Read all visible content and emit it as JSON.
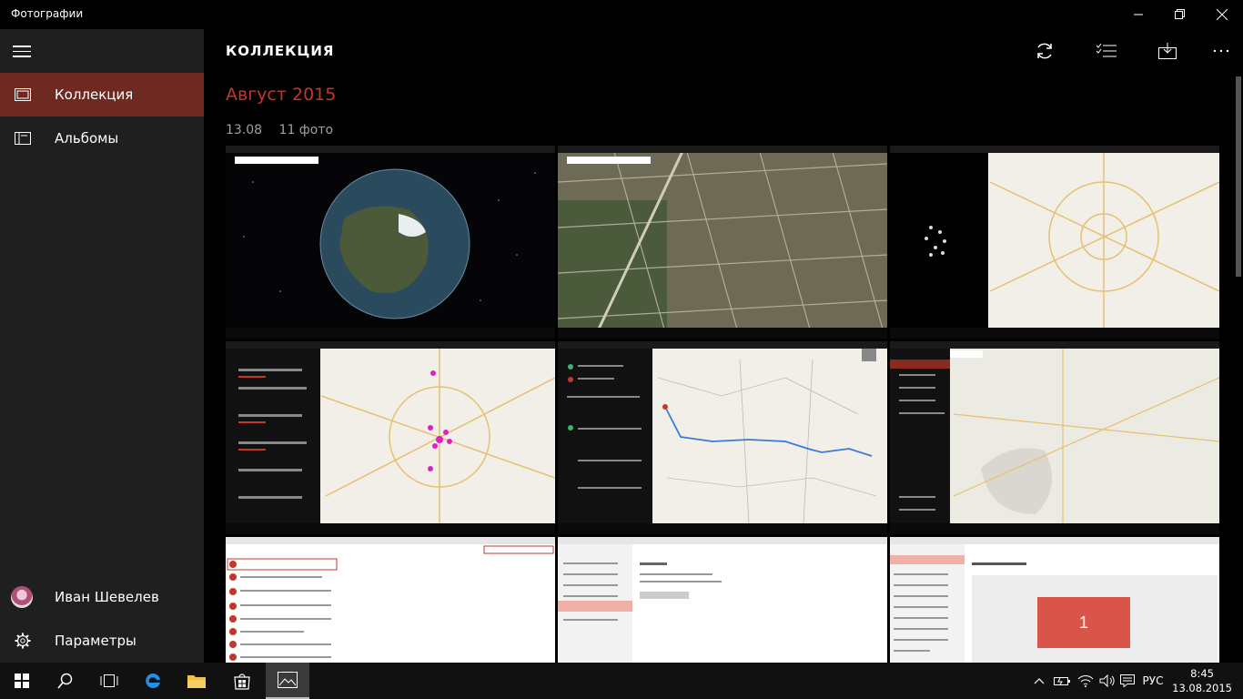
{
  "window": {
    "title": "Фотографии"
  },
  "nav": {
    "items": [
      {
        "label": "Коллекция",
        "icon": "collection-icon"
      },
      {
        "label": "Альбомы",
        "icon": "albums-icon"
      }
    ],
    "user": {
      "name": "Иван Шевелев"
    },
    "settings": {
      "label": "Параметры"
    }
  },
  "header": {
    "title": "КОЛЛЕКЦИЯ",
    "actions": [
      "refresh-icon",
      "select-icon",
      "import-icon",
      "more-icon"
    ]
  },
  "content": {
    "month": "Август 2015",
    "date": "13.08",
    "count": "11 фото",
    "thumbnail_center_label": "1"
  },
  "taskbar": {
    "language": "РУС",
    "time": "8:45",
    "date": "13.08.2015"
  },
  "colors": {
    "accent": "#6e2a21",
    "month": "#c0392b",
    "map_pin": "#e020c0"
  }
}
